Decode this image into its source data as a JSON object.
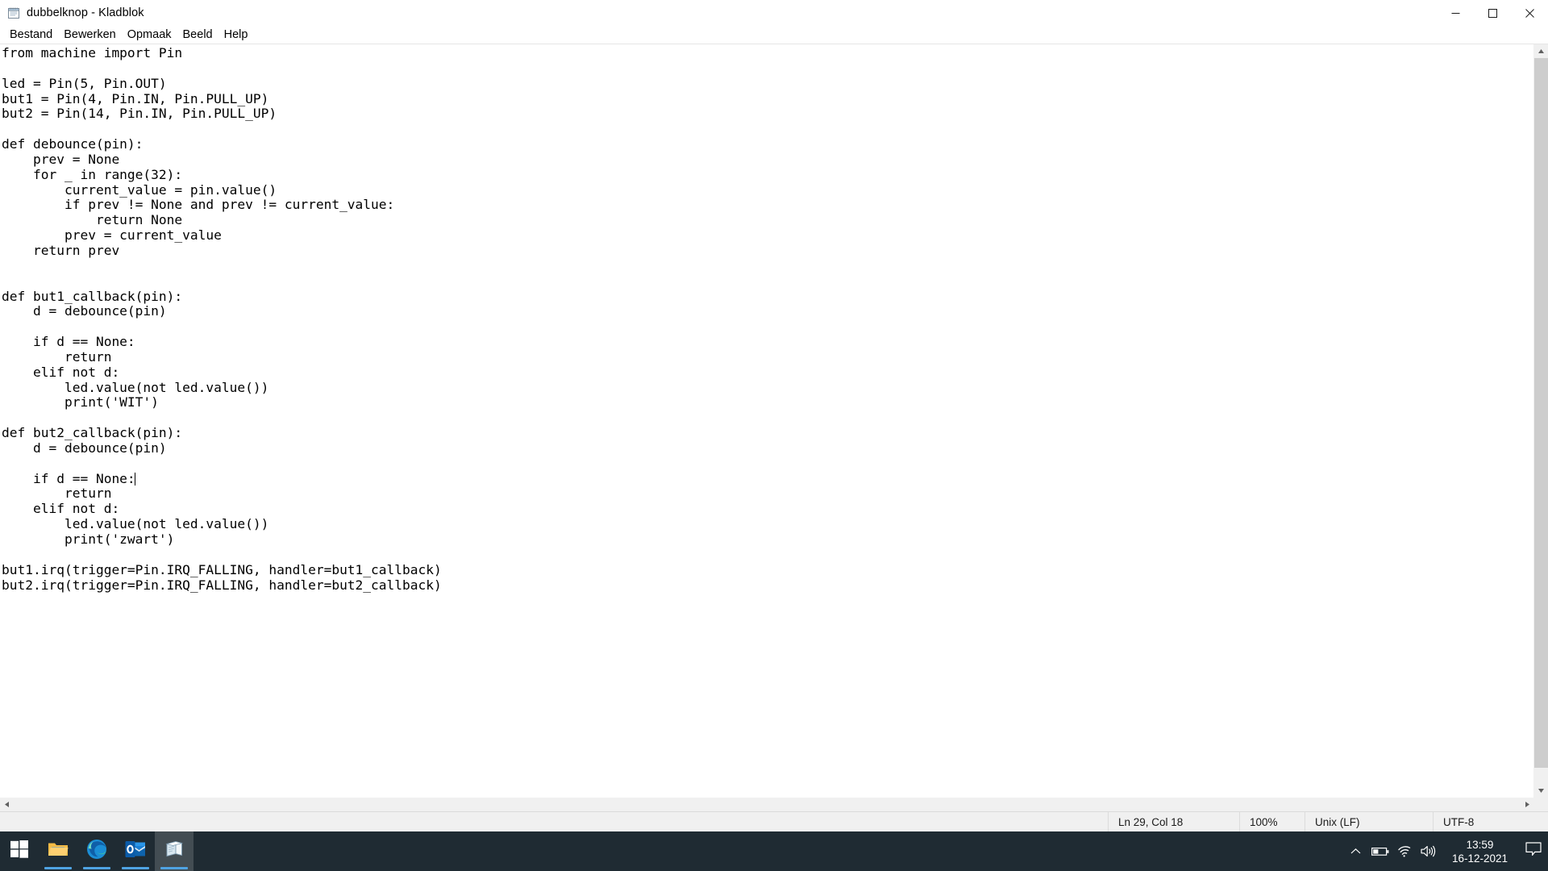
{
  "window": {
    "title": "dubbelknop - Kladblok",
    "icon": "notepad-icon",
    "controls": {
      "minimize": "—",
      "maximize": "❑",
      "close": "✕"
    }
  },
  "menu": {
    "items": [
      {
        "label": "Bestand",
        "name": "menu-bestand"
      },
      {
        "label": "Bewerken",
        "name": "menu-bewerken"
      },
      {
        "label": "Opmaak",
        "name": "menu-opmaak"
      },
      {
        "label": "Beeld",
        "name": "menu-beeld"
      },
      {
        "label": "Help",
        "name": "menu-help"
      }
    ]
  },
  "editor": {
    "text_before_caret": "from machine import Pin\n\nled = Pin(5, Pin.OUT)\nbut1 = Pin(4, Pin.IN, Pin.PULL_UP)\nbut2 = Pin(14, Pin.IN, Pin.PULL_UP)\n\ndef debounce(pin):\n    prev = None\n    for _ in range(32):\n        current_value = pin.value()\n        if prev != None and prev != current_value:\n            return None\n        prev = current_value\n    return prev\n\n\ndef but1_callback(pin):\n    d = debounce(pin)\n\n    if d == None:\n        return\n    elif not d:\n        led.value(not led.value())\n        print('WIT')\n\ndef but2_callback(pin):\n    d = debounce(pin)\n\n    if d == None:",
    "text_after_caret": "\n        return\n    elif not d:\n        led.value(not led.value())\n        print('zwart')\n\nbut1.irq(trigger=Pin.IRQ_FALLING, handler=but1_callback)\nbut2.irq(trigger=Pin.IRQ_FALLING, handler=but2_callback)\n",
    "full_text": "from machine import Pin\n\nled = Pin(5, Pin.OUT)\nbut1 = Pin(4, Pin.IN, Pin.PULL_UP)\nbut2 = Pin(14, Pin.IN, Pin.PULL_UP)\n\ndef debounce(pin):\n    prev = None\n    for _ in range(32):\n        current_value = pin.value()\n        if prev != None and prev != current_value:\n            return None\n        prev = current_value\n    return prev\n\n\ndef but1_callback(pin):\n    d = debounce(pin)\n\n    if d == None:\n        return\n    elif not d:\n        led.value(not led.value())\n        print('WIT')\n\ndef but2_callback(pin):\n    d = debounce(pin)\n\n    if d == None:\n        return\n    elif not d:\n        led.value(not led.value())\n        print('zwart')\n\nbut1.irq(trigger=Pin.IRQ_FALLING, handler=but1_callback)\nbut2.irq(trigger=Pin.IRQ_FALLING, handler=but2_callback)\n"
  },
  "scrollbars": {
    "up_arrow": "▲",
    "down_arrow": "▼",
    "left_arrow": "◀",
    "right_arrow": "▶"
  },
  "statusbar": {
    "cursor_position": "Ln 29, Col 18",
    "zoom": "100%",
    "line_ending": "Unix (LF)",
    "encoding": "UTF-8"
  },
  "taskbar": {
    "items": [
      {
        "name": "start-button",
        "icon": "windows-logo-icon",
        "label": "Start"
      },
      {
        "name": "taskbar-file-explorer",
        "icon": "folder-icon",
        "label": "Verkenner"
      },
      {
        "name": "taskbar-edge",
        "icon": "edge-icon",
        "label": "Microsoft Edge"
      },
      {
        "name": "taskbar-outlook",
        "icon": "outlook-icon",
        "label": "Outlook"
      },
      {
        "name": "taskbar-notepad",
        "icon": "notepad-icon",
        "label": "Kladblok"
      }
    ],
    "tray": [
      {
        "name": "show-hidden-icons",
        "icon": "chevron-up-icon"
      },
      {
        "name": "battery-status",
        "icon": "battery-icon"
      },
      {
        "name": "network-status",
        "icon": "wifi-icon"
      },
      {
        "name": "volume-control",
        "icon": "speaker-icon"
      }
    ],
    "clock": {
      "time": "13:59",
      "date": "16-12-2021"
    },
    "notifications": {
      "name": "action-center",
      "icon": "speech-bubble-icon"
    }
  },
  "colors": {
    "taskbar_bg": "#1f2b33",
    "accent": "#4fa3e3",
    "statusbar_bg": "#f0f0f0",
    "close_hover": "#e81123"
  }
}
